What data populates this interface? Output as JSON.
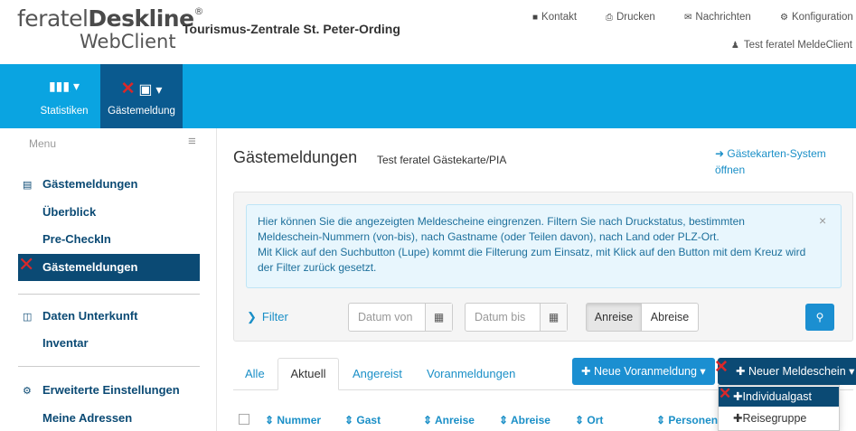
{
  "logo": {
    "brand_light": "feratel",
    "brand_bold": "Deskline",
    "reg": "®",
    "sub": "WebClient"
  },
  "org_title": "Tourismus-Zentrale St. Peter-Ording",
  "top_links": [
    {
      "icon": "contact-icon",
      "label": "Kontakt"
    },
    {
      "icon": "print-icon",
      "label": "Drucken"
    },
    {
      "icon": "mail-icon",
      "label": "Nachrichten"
    },
    {
      "icon": "gear-icon",
      "label": "Konfiguration"
    }
  ],
  "user": "Test feratel MeldeClient",
  "nav": [
    {
      "icon": "bar-chart-icon",
      "label": "Statistiken",
      "active": false
    },
    {
      "icon": "document-copy-icon",
      "label": "Gästemeldung",
      "active": true
    }
  ],
  "sidebar": {
    "menu_label": "Menu",
    "groups": [
      {
        "icon": "list-icon",
        "label": "Gästemeldungen",
        "items": [
          "Überblick",
          "Pre-CheckIn",
          "Gästemeldungen"
        ]
      },
      {
        "icon": "columns-icon",
        "label": "Daten Unterkunft",
        "items": [
          "Inventar"
        ]
      },
      {
        "icon": "cogs-icon",
        "label": "Erweiterte Einstellungen",
        "items": [
          "Meine Adressen"
        ]
      }
    ]
  },
  "content": {
    "title": "Gästemeldungen",
    "subtitle": "Test feratel Gästekarte/PIA",
    "ext_link": "Gästekarten-System öffnen",
    "alert_lines": [
      "Hier können Sie die angezeigten Meldescheine eingrenzen. Filtern Sie nach Druckstatus, bestimmten",
      "Meldeschein-Nummern (von-bis), nach Gastname (oder Teilen davon), nach Land oder PLZ-Ort.",
      "Mit Klick auf den Suchbutton (Lupe) kommt die Filterung zum Einsatz, mit Klick auf den Button mit dem Kreuz wird",
      "der Filter zurück gesetzt."
    ],
    "filter_label": "Filter",
    "date_from_placeholder": "Datum von",
    "date_to_placeholder": "Datum bis",
    "toggle_arrival": "Anreise",
    "toggle_departure": "Abreise",
    "tabs": [
      "Alle",
      "Aktuell",
      "Angereist",
      "Voranmeldungen"
    ],
    "btn_pre": "Neue Voranmeldung",
    "btn_new": "Neuer Meldeschein",
    "dropdown": [
      "Individualgast",
      "Reisegruppe"
    ],
    "columns": [
      "Nummer",
      "Gast",
      "Anreise",
      "Abreise",
      "Ort",
      "Personen"
    ]
  },
  "colors": {
    "header_blue": "#0aa4e1",
    "nav_active": "#0a5a8f",
    "dark_blue": "#0b4a74",
    "link_blue": "#1a8fc7",
    "marker_red": "#d9282a"
  }
}
